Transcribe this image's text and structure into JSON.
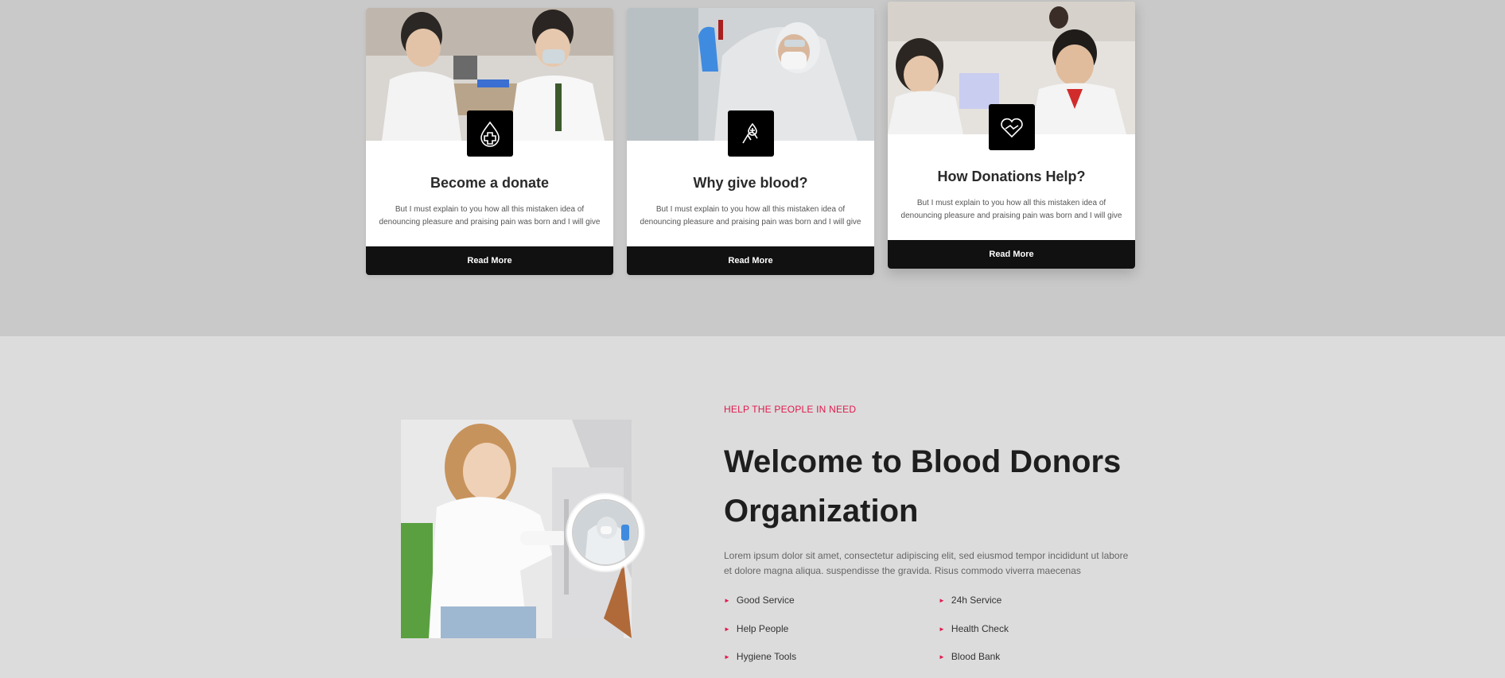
{
  "cards": [
    {
      "title": "Become a donate",
      "text": "But I must explain to you how all this mistaken idea of denouncing pleasure and praising pain was born and I will give",
      "button": "Read More",
      "icon": "blood-drop-cross-icon"
    },
    {
      "title": "Why give blood?",
      "text": "But I must explain to you how all this mistaken idea of denouncing pleasure and praising pain was born and I will give",
      "button": "Read More",
      "icon": "hand-blood-drop-icon"
    },
    {
      "title": "How Donations Help?",
      "text": "But I must explain to you how all this mistaken idea of denouncing pleasure and praising pain was born and I will give",
      "button": "Read More",
      "icon": "heart-hands-icon"
    }
  ],
  "about": {
    "tagline": "HELP THE PEOPLE IN NEED",
    "heading": "Welcome to Blood Donors Organization",
    "paragraph": "Lorem ipsum dolor sit amet, consectetur adipiscing elit, sed eiusmod tempor incididunt ut labore et dolore magna aliqua. suspendisse the gravida. Risus commodo viverra maecenas",
    "features": [
      "Good Service",
      "24h Service",
      "Help People",
      "Health Check",
      "Hygiene Tools",
      "Blood Bank"
    ]
  },
  "colors": {
    "accent": "#e0194d",
    "dark": "#111111",
    "top_band": "#c9c9c9",
    "page_bg": "#dcdcdc"
  }
}
